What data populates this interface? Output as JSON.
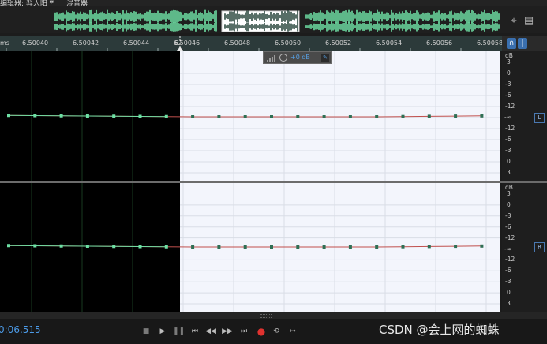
{
  "tabs": {
    "editor_tab": "编辑器: 羿人阳 *",
    "menu_symbol": "≡",
    "mixer_tab": "混音器"
  },
  "ruler": {
    "unit": "ms",
    "playhead_label": "6.",
    "ticks": [
      {
        "label": "6.50040"
      },
      {
        "label": "6.50042"
      },
      {
        "label": "6.50044"
      },
      {
        "label": "6.50046"
      },
      {
        "label": "6.50048"
      },
      {
        "label": "6.50050"
      },
      {
        "label": "6.50052"
      },
      {
        "label": "6.50054"
      },
      {
        "label": "6.50056"
      },
      {
        "label": "6.50058"
      }
    ],
    "snap_button": "∩",
    "marker_button": "|"
  },
  "hud": {
    "gain": "+0 dB",
    "pin_icon": "pin-icon"
  },
  "channels": [
    {
      "name": "L",
      "db_unit": "dB",
      "db_scale": [
        "3",
        "0",
        "-3",
        "-6",
        "-12",
        "-∞",
        "-12",
        "-6",
        "-3",
        "0",
        "3"
      ]
    },
    {
      "name": "R",
      "db_unit": "dB",
      "db_scale": [
        "3",
        "0",
        "-3",
        "-6",
        "-12",
        "-∞",
        "-12",
        "-6",
        "-3",
        "0",
        "3"
      ]
    }
  ],
  "transport": {
    "timecode": "0:06.515",
    "buttons": [
      "stop-icon",
      "play-icon",
      "pause-icon",
      "go-to-start-icon",
      "rewind-icon",
      "fast-forward-icon",
      "go-to-end-icon",
      "record-icon",
      "loop-icon",
      "skip-selection-icon"
    ]
  },
  "watermark": "CSDN @会上网的蜘蛛",
  "colors": {
    "waveform": "#6ee0a4",
    "sample_dot": "#2f6f55",
    "sample_line": "#c0504d",
    "selection_bg": "#f3f5fc",
    "accent": "#4c9be8",
    "record": "#e0322f"
  }
}
